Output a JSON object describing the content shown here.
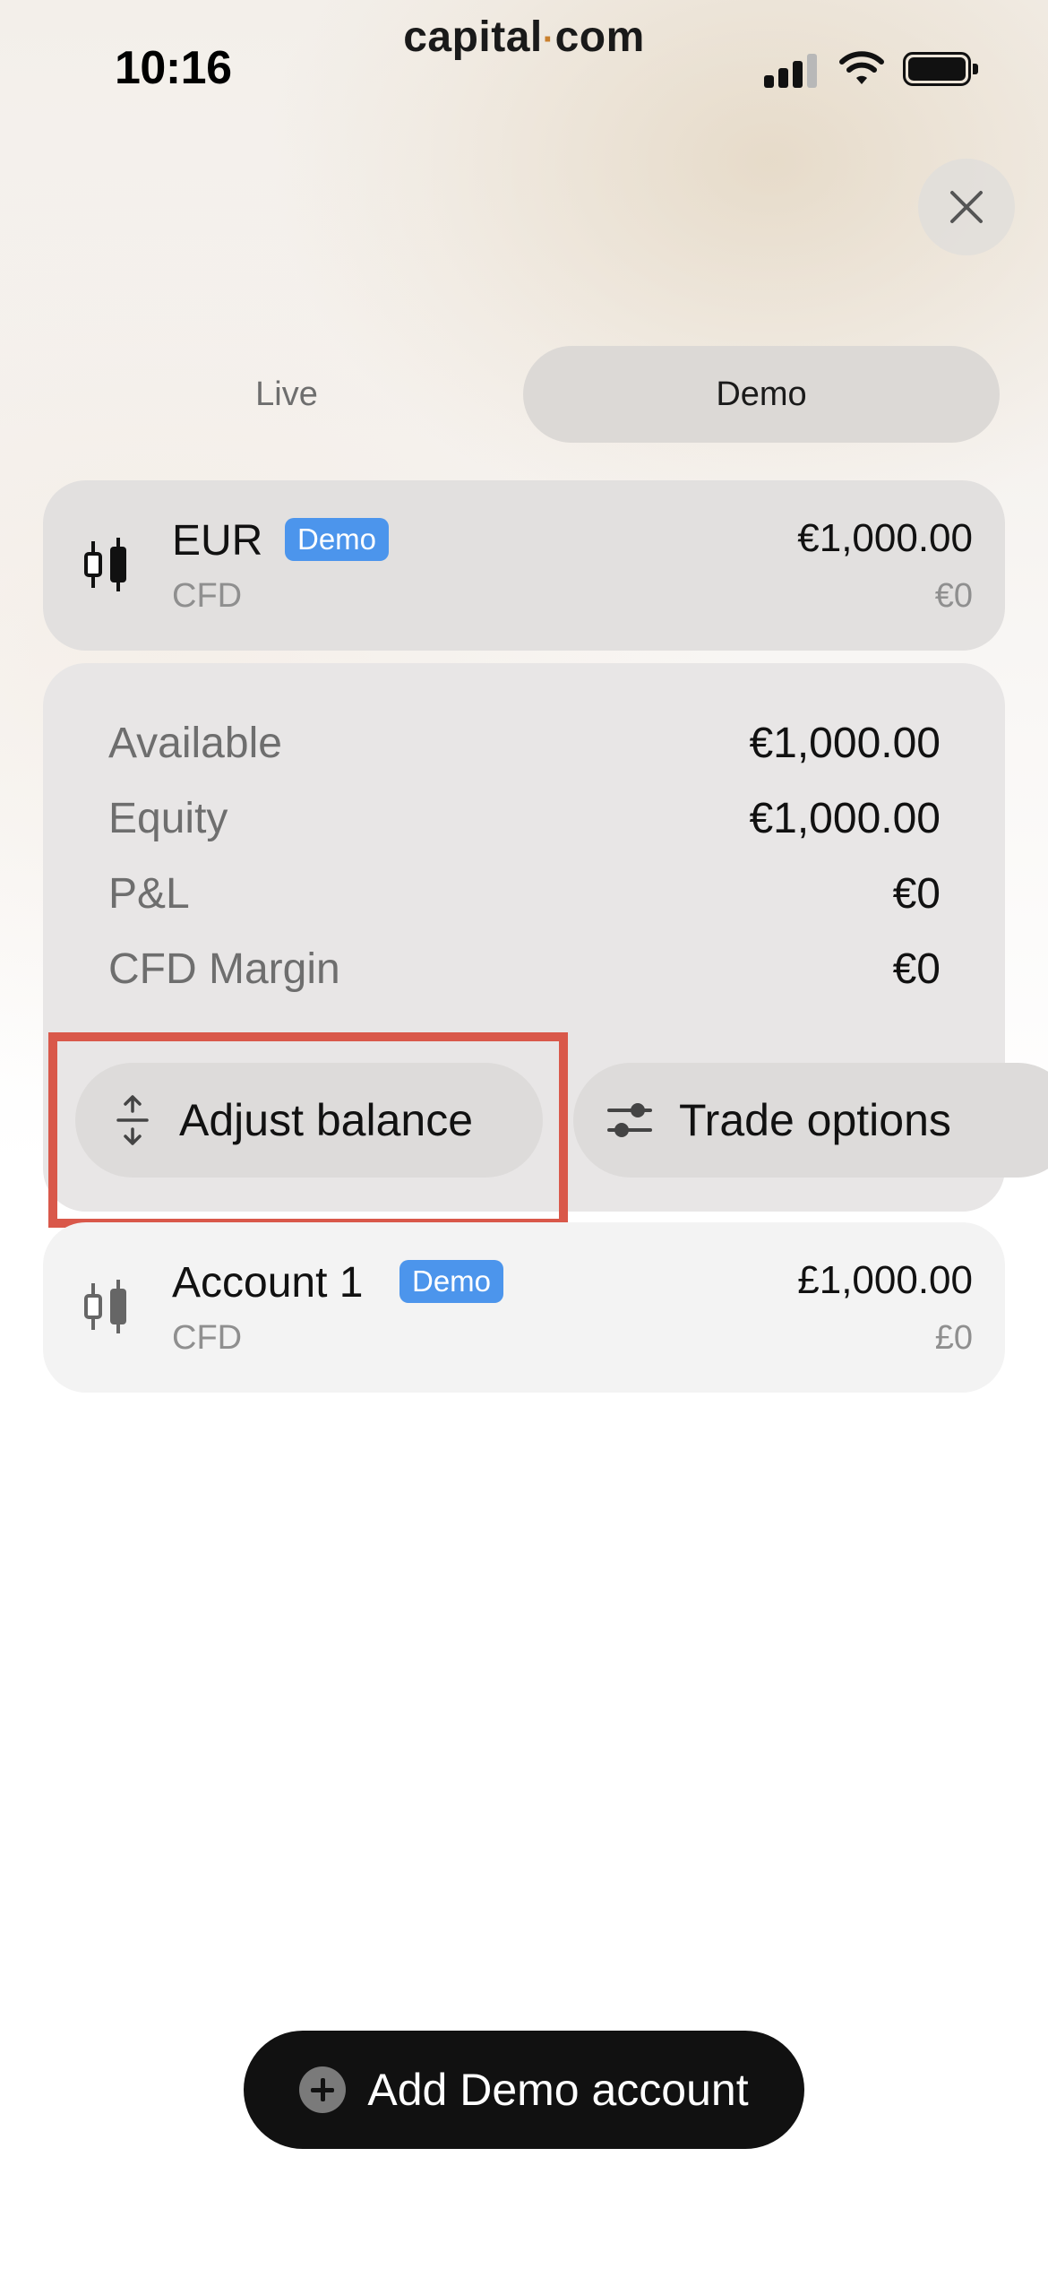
{
  "status_bar": {
    "time": "10:16",
    "brand_left": "capital",
    "brand_dot": "·",
    "brand_right": "com"
  },
  "tabs": {
    "live": "Live",
    "demo": "Demo",
    "selected": "Demo"
  },
  "accounts": [
    {
      "name": "EUR",
      "badge": "Demo",
      "type": "CFD",
      "balance": "€1,000.00",
      "pnl": "€0",
      "icon": "candlestick-icon"
    },
    {
      "name": "Account 1",
      "badge": "Demo",
      "type": "CFD",
      "balance": "£1,000.00",
      "pnl": "£0",
      "icon": "candlestick-icon"
    }
  ],
  "details": {
    "rows": [
      {
        "label": "Available",
        "value": "€1,000.00"
      },
      {
        "label": "Equity",
        "value": "€1,000.00"
      },
      {
        "label": "P&L",
        "value": "€0"
      },
      {
        "label": "CFD Margin",
        "value": "€0"
      }
    ],
    "adjust_label": "Adjust balance",
    "trade_label": "Trade options"
  },
  "add_button": {
    "label": "Add Demo account"
  },
  "colors": {
    "badge": "#4c95ec",
    "highlight": "#d9584a",
    "primary_button": "#111111"
  }
}
